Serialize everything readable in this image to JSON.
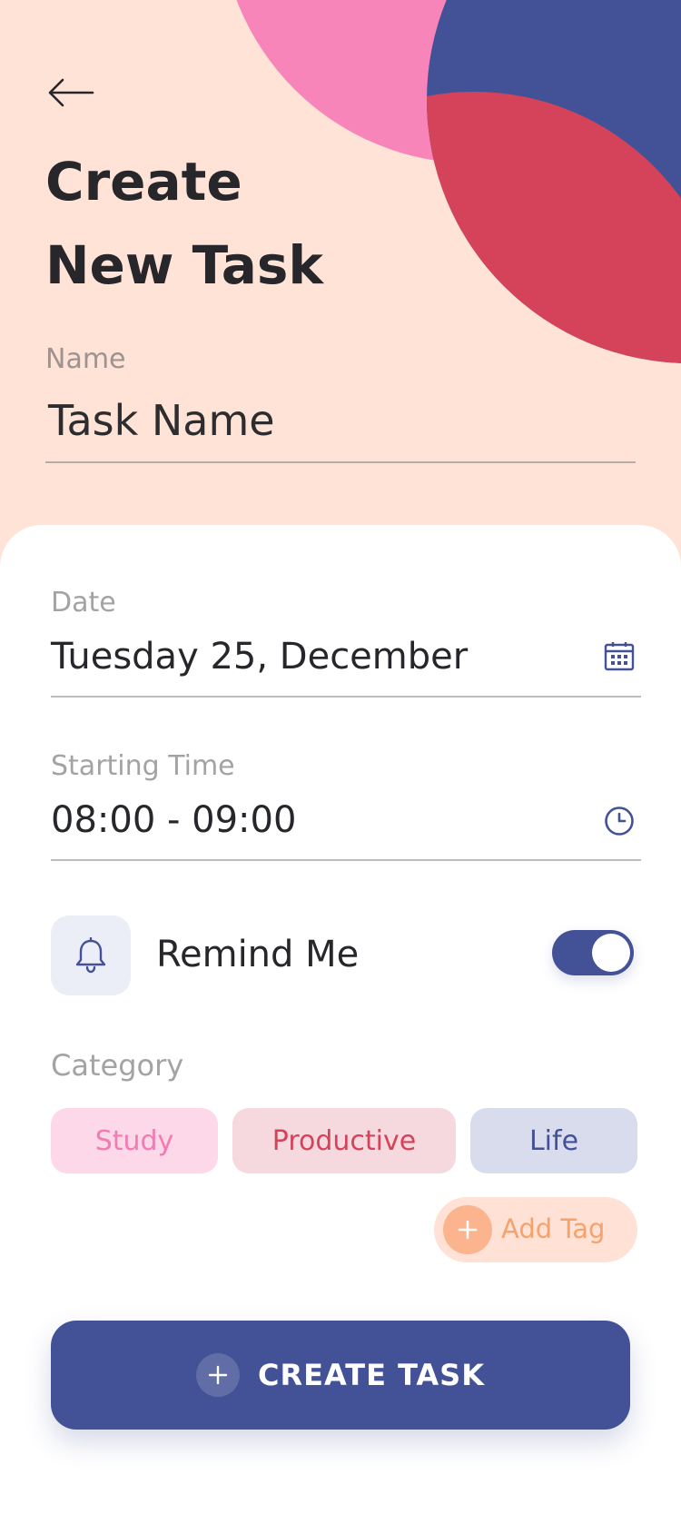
{
  "header": {
    "back_icon": "arrow-left-icon",
    "title_line1": "Create",
    "title_line2": "New Task"
  },
  "name_field": {
    "label": "Name",
    "value": "Task Name"
  },
  "date_field": {
    "label": "Date",
    "value": "Tuesday 25, December",
    "icon": "calendar-icon"
  },
  "time_field": {
    "label": "Starting Time",
    "value": "08:00 - 09:00",
    "icon": "clock-icon"
  },
  "reminder": {
    "icon": "bell-icon",
    "label": "Remind Me",
    "enabled": true
  },
  "category": {
    "label": "Category",
    "chips": [
      {
        "label": "Study",
        "bg": "#fdd8e9",
        "fg": "#f37bb2"
      },
      {
        "label": "Productive",
        "bg": "#f6d9de",
        "fg": "#d4435a"
      },
      {
        "label": "Life",
        "bg": "#d8dced",
        "fg": "#435296"
      }
    ],
    "add_tag_label": "Add Tag"
  },
  "action": {
    "create_label": "CREATE TASK",
    "icon": "plus-icon"
  },
  "colors": {
    "background": "#ffe3d6",
    "accent_blue": "#435296",
    "accent_pink": "#f885b9",
    "accent_red": "#d4435a",
    "accent_orange": "#f4a26e"
  }
}
